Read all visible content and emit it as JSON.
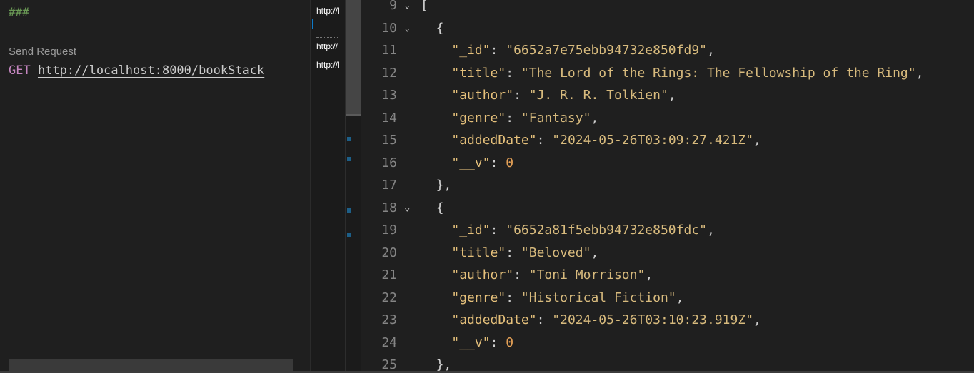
{
  "request_editor": {
    "hash_line": "###",
    "codelens": "Send Request",
    "method": "GET",
    "url": "http://localhost:8000/bookStack"
  },
  "minimap": {
    "tabs": [
      "http://l",
      "http://",
      "http://l"
    ]
  },
  "response": {
    "lines": [
      {
        "num": "9",
        "fold": true,
        "indent": "",
        "text": "["
      },
      {
        "num": "10",
        "fold": true,
        "indent": "  ",
        "text": "{"
      },
      {
        "num": "11",
        "indent": "    ",
        "key": "_id",
        "value": "\"6652a7e75ebb94732e850fd9\"",
        "type": "string",
        "trail": ","
      },
      {
        "num": "12",
        "indent": "    ",
        "key": "title",
        "value": "\"The Lord of the Rings: The Fellowship of the Ring\"",
        "type": "string",
        "trail": ","
      },
      {
        "num": "13",
        "indent": "    ",
        "key": "author",
        "value": "\"J. R. R. Tolkien\"",
        "type": "string",
        "trail": ","
      },
      {
        "num": "14",
        "indent": "    ",
        "key": "genre",
        "value": "\"Fantasy\"",
        "type": "string",
        "trail": ","
      },
      {
        "num": "15",
        "indent": "    ",
        "key": "addedDate",
        "value": "\"2024-05-26T03:09:27.421Z\"",
        "type": "string",
        "trail": ","
      },
      {
        "num": "16",
        "indent": "    ",
        "key": "__v",
        "value": "0",
        "type": "number",
        "trail": ""
      },
      {
        "num": "17",
        "indent": "  ",
        "text": "},"
      },
      {
        "num": "18",
        "fold": true,
        "indent": "  ",
        "text": "{"
      },
      {
        "num": "19",
        "indent": "    ",
        "key": "_id",
        "value": "\"6652a81f5ebb94732e850fdc\"",
        "type": "string",
        "trail": ","
      },
      {
        "num": "20",
        "indent": "    ",
        "key": "title",
        "value": "\"Beloved\"",
        "type": "string",
        "trail": ","
      },
      {
        "num": "21",
        "indent": "    ",
        "key": "author",
        "value": "\"Toni Morrison\"",
        "type": "string",
        "trail": ","
      },
      {
        "num": "22",
        "indent": "    ",
        "key": "genre",
        "value": "\"Historical Fiction\"",
        "type": "string",
        "trail": ","
      },
      {
        "num": "23",
        "indent": "    ",
        "key": "addedDate",
        "value": "\"2024-05-26T03:10:23.919Z\"",
        "type": "string",
        "trail": ","
      },
      {
        "num": "24",
        "indent": "    ",
        "key": "__v",
        "value": "0",
        "type": "number",
        "trail": ""
      },
      {
        "num": "25",
        "indent": "  ",
        "text": "},"
      }
    ]
  },
  "colors": {
    "background": "#1f1f1f",
    "key": "#9cdcfe",
    "string": "#ce9178",
    "number": "#b5cea8",
    "comment": "#6a9955",
    "method": "#c586c0"
  }
}
